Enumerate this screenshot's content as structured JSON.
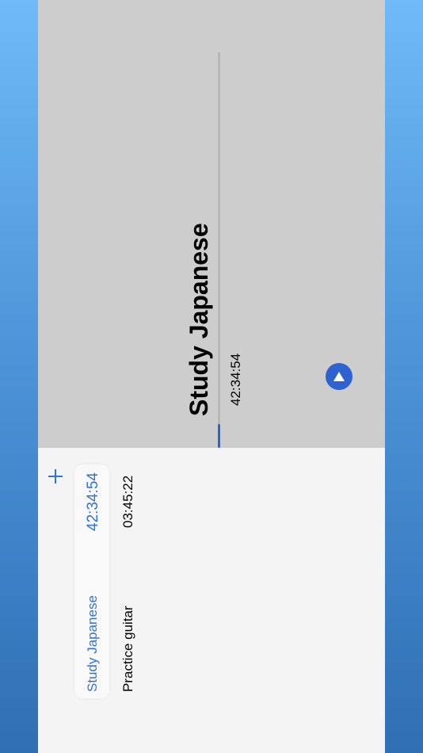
{
  "detail": {
    "title": "Study Japanese",
    "elapsed": "42:34:54",
    "progress_fraction": 0.06
  },
  "tasks": [
    {
      "name": "Study Japanese",
      "time": "42:34:54",
      "selected": true
    },
    {
      "name": "Practice guitar",
      "time": "03:45:22",
      "selected": false
    }
  ],
  "colors": {
    "accent": "#2f62d1",
    "selected_text": "#2f73d8",
    "detail_bg": "#cdcdcd",
    "list_bg": "#f4f4f4"
  },
  "icons": {
    "add": "plus-icon",
    "play": "play-triangle-icon"
  }
}
